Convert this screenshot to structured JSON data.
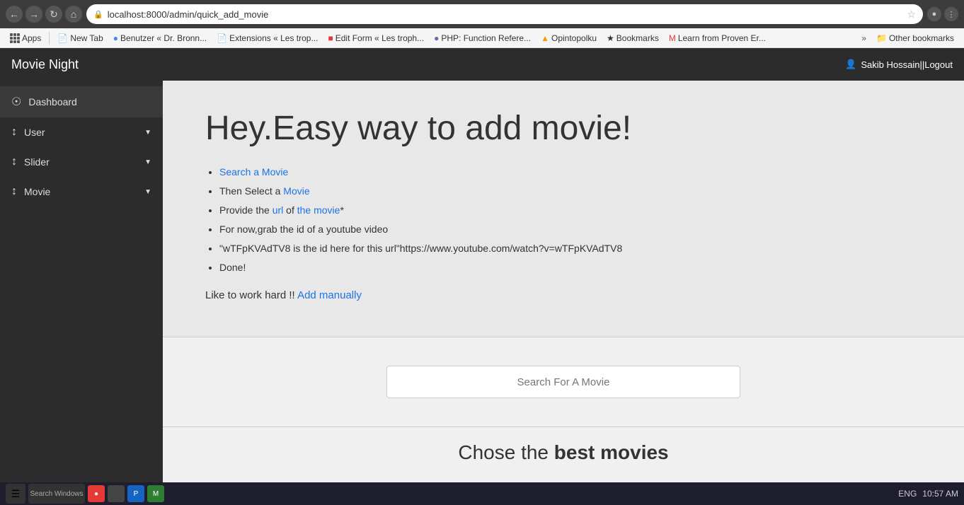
{
  "browser": {
    "url": "localhost:8000/admin/quick_add_movie",
    "bookmarks": [
      {
        "label": "Apps",
        "type": "apps"
      },
      {
        "label": "New Tab",
        "type": "tab"
      },
      {
        "label": "Benutzer « Dr. Bronn...",
        "type": "tab"
      },
      {
        "label": "Extensions « Les trop...",
        "type": "tab"
      },
      {
        "label": "Edit Form « Les troph...",
        "type": "tab"
      },
      {
        "label": "PHP: Function Refere...",
        "type": "tab"
      },
      {
        "label": "Opintopolku",
        "type": "tab"
      },
      {
        "label": "Bookmarks",
        "type": "tab"
      },
      {
        "label": "Learn from Proven Er...",
        "type": "tab"
      }
    ],
    "more_label": "»",
    "other_bookmarks": "Other bookmarks"
  },
  "app": {
    "title": "Movie Night",
    "user_label": "Sakib Hossain||Logout"
  },
  "sidebar": {
    "items": [
      {
        "label": "Dashboard",
        "icon": "⊙",
        "active": true
      },
      {
        "label": "User",
        "icon": "↕",
        "has_arrow": true
      },
      {
        "label": "Slider",
        "icon": "↕",
        "has_arrow": true
      },
      {
        "label": "Movie",
        "icon": "↕",
        "has_arrow": true
      }
    ]
  },
  "hero": {
    "title": "Hey.Easy way to add movie!",
    "instructions": [
      "Search a Movie",
      "Then Select a Movie",
      "Provide the url of the movie*",
      "For now,grab the id of a youtube video",
      "\"wTFpKVAdTV8 is the id here for this url\"https://www.youtube.com/watch?v=wTFpKVAdTV8",
      "Done!"
    ],
    "work_hard_text": "Like to work hard !! ",
    "add_manually_label": "Add manually"
  },
  "search": {
    "placeholder": "Search For A Movie"
  },
  "bottom": {
    "text_normal": "Chose the ",
    "text_bold": "best movies"
  },
  "taskbar": {
    "time": "10:57 AM",
    "lang": "ENG"
  }
}
